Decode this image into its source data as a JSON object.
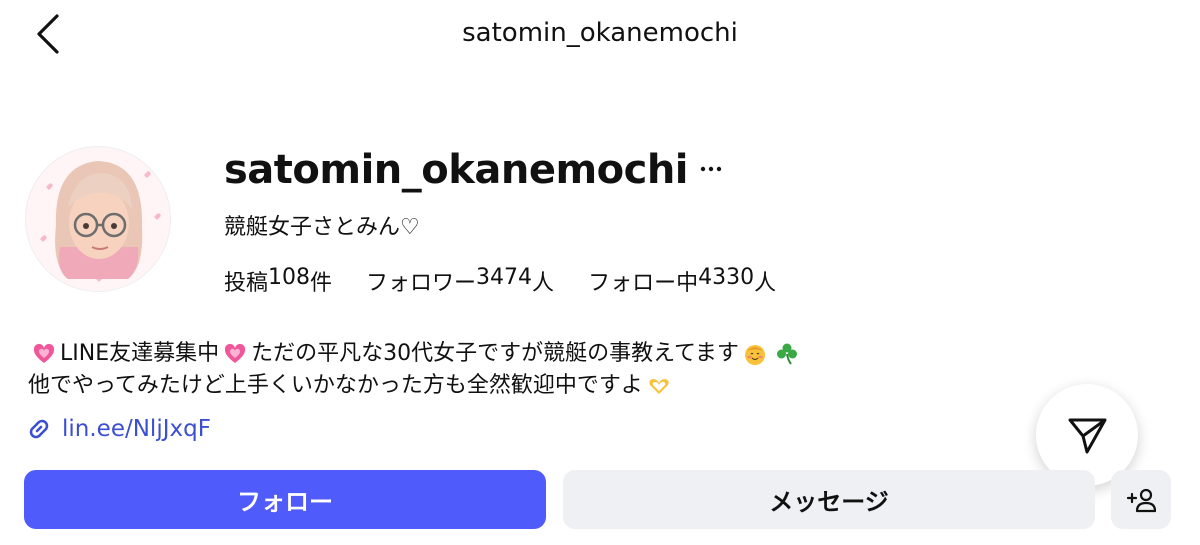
{
  "header": {
    "title": "satomin_okanemochi"
  },
  "profile": {
    "username": "satomin_okanemochi",
    "display_name": "競艇女子さとみん♡",
    "stats": {
      "posts_label": "投稿",
      "posts_count": "108",
      "posts_unit": "件",
      "followers_label": "フォロワー",
      "followers_count": "3474",
      "followers_unit": "人",
      "following_label": "フォロー中",
      "following_count": "4330",
      "following_unit": "人"
    },
    "bio": {
      "line1_part1": "LINE友達募集中",
      "line1_part2": "ただの平凡な30代女子ですが競艇の事教えてます",
      "line2": "他でやってみたけど上手くいかなかった方も全然歓迎中ですよ"
    },
    "link": "lin.ee/NljJxqF"
  },
  "actions": {
    "follow_label": "フォロー",
    "message_label": "メッセージ"
  },
  "icons": {
    "back": "chevron-left-icon",
    "more": "more-horizontal-icon",
    "link": "link-icon",
    "send": "paper-plane-icon",
    "add_person": "add-person-icon",
    "heart": "pink-heart-emoji",
    "face": "smiling-face-emoji",
    "clover": "shamrock-emoji",
    "heart_hands": "heart-hands-emoji"
  },
  "colors": {
    "accent": "#4f5bfa",
    "link": "#3b4fd1",
    "secondary_button": "#eff0f3"
  }
}
